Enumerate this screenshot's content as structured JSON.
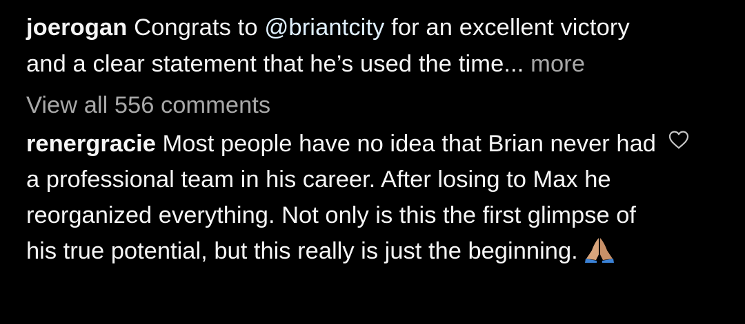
{
  "caption": {
    "username": "joerogan",
    "text_before": " Congrats to ",
    "mention": "@briantcity",
    "text_line1_after": " for an excellent victory",
    "text_line2": "and a clear statement that he’s used the time",
    "ellipsis": "...",
    "more_label": " more"
  },
  "view_all_label": "View all 556 comments",
  "comment": {
    "username": "renergracie",
    "text": " Most people have no idea that Brian never had a professional team in his career. After losing to Max he reorganized everything. Not only is this the first glimpse of his true potential, but this really is just the beginning.",
    "emoji_icon": "folded-hands-icon"
  },
  "colors": {
    "background": "#000000",
    "text": "#f5f5f5",
    "secondary": "#a8a8a8",
    "mention": "#e0f1ff"
  }
}
